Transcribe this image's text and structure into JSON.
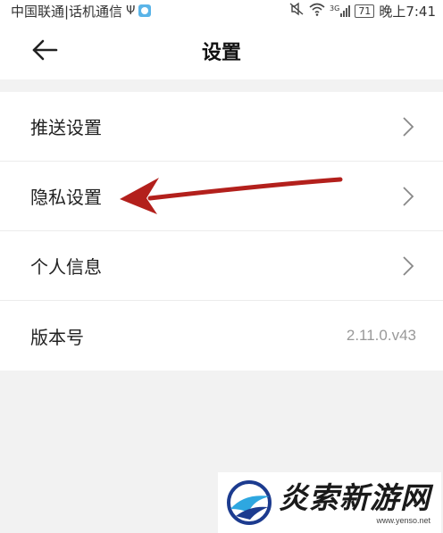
{
  "status_bar": {
    "carrier": "中国联通|话机通信",
    "network_type": "3G",
    "battery": "71",
    "time": "晚上7:41"
  },
  "header": {
    "title": "设置"
  },
  "settings": {
    "items": [
      {
        "label": "推送设置"
      },
      {
        "label": "隐私设置"
      },
      {
        "label": "个人信息"
      },
      {
        "label": "版本号",
        "value": "2.11.0.v43"
      }
    ]
  },
  "annotation": {
    "color": "#b3201c"
  },
  "watermark": {
    "brand": "炎索新游网",
    "url": "www.yenso.net"
  }
}
